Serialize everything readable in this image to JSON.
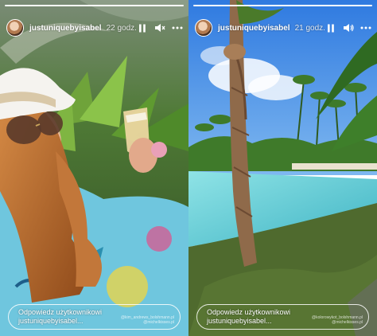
{
  "stories": [
    {
      "username": "justuniquebyisabel",
      "time": "22 godz.",
      "progress_fraction": 1.0,
      "reply_line1": "Odpowiedz użytkownikowi",
      "reply_line2": "justuniquebyisabel...",
      "watermark": [
        "@kim_andrews_bolshmann.pl",
        "@michelkisses.pl"
      ]
    },
    {
      "username": "justuniquebyisabel",
      "time": "21 godz.",
      "progress_fraction": 1.0,
      "reply_line1": "Odpowiedz użytkownikowi",
      "reply_line2": "justuniquebyisabel...",
      "watermark": [
        "@kolorowykot_bolshmann.pl",
        "@michelkisses.pl"
      ]
    }
  ],
  "colors": {
    "sky": "#3f89e8",
    "pool": "#5fd0d6",
    "foliage": "#3f7a2a",
    "dress": "#6fc6de",
    "hair": "#b86a2c"
  },
  "icons": [
    "pause-icon",
    "mute-icon",
    "more-icon"
  ]
}
